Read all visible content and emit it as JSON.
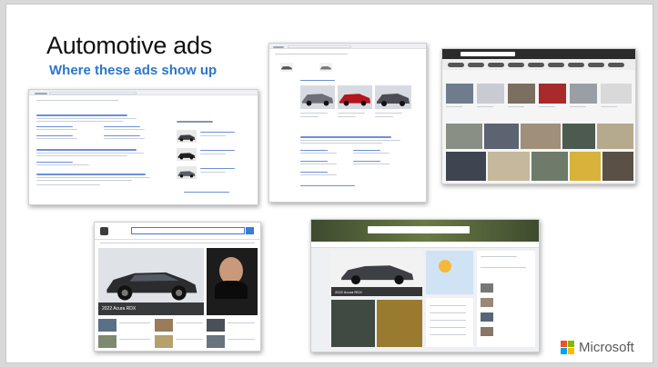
{
  "slide": {
    "title": "Automotive ads",
    "subtitle": "Where these ads show up"
  },
  "brand": {
    "name": "Microsoft",
    "colors": [
      "#f25022",
      "#7fba00",
      "#00a4ef",
      "#ffb900"
    ]
  },
  "screenshots": [
    {
      "id": "bing-search-results",
      "query": "contoso car sales"
    },
    {
      "id": "bing-shopping-results",
      "query": "contoso car"
    },
    {
      "id": "bing-image-results",
      "query": "contoso sedan"
    },
    {
      "id": "msn-homepage",
      "caption": "2022 Acura RDX"
    },
    {
      "id": "microsoft-start-feed",
      "caption": "2022 Acura RDX"
    }
  ],
  "colors": {
    "accent_blue": "#2b78c8",
    "title_text": "#111111"
  }
}
